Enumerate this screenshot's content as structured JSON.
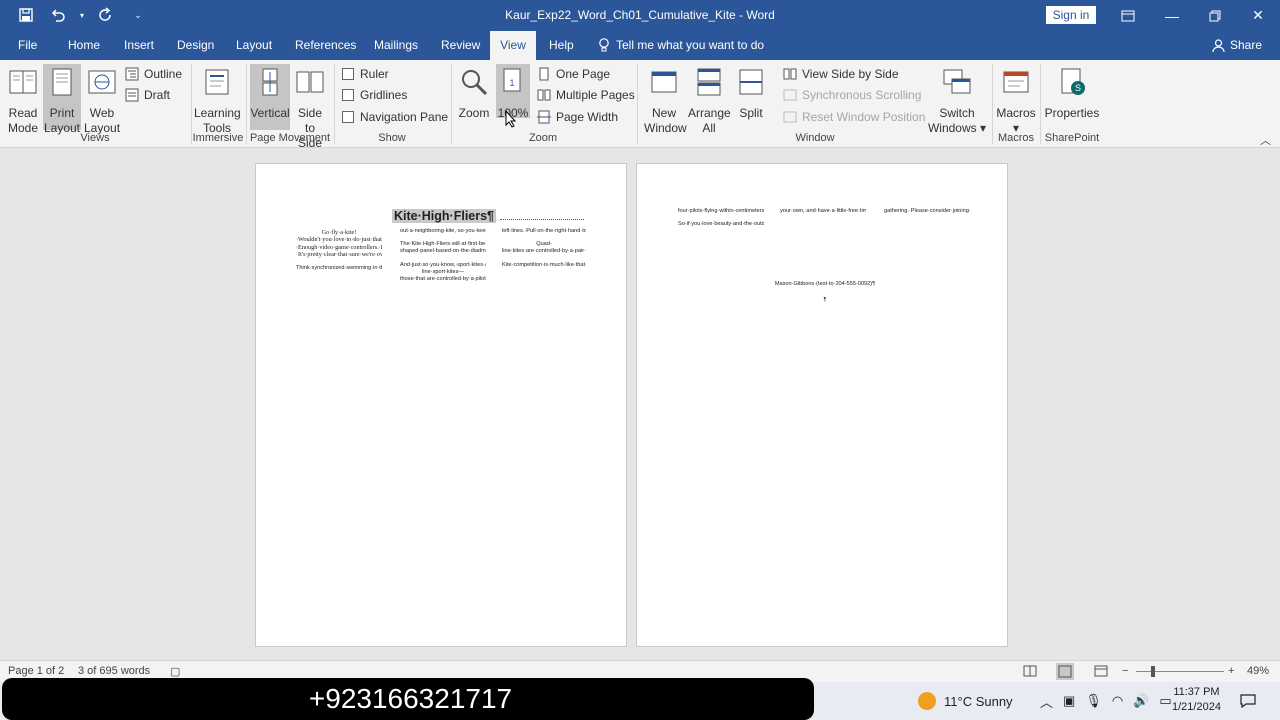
{
  "window": {
    "title": "Kaur_Exp22_Word_Ch01_Cumulative_Kite  -  Word",
    "signin": "Sign in"
  },
  "tabs": [
    "File",
    "Home",
    "Insert",
    "Design",
    "Layout",
    "References",
    "Mailings",
    "Review",
    "View",
    "Help"
  ],
  "tellme": "Tell me what you want to do",
  "share": "Share",
  "ribbon": {
    "views": {
      "label": "Views",
      "read_mode": "Read Mode",
      "print_layout": "Print Layout",
      "web_layout": "Web Layout",
      "outline": "Outline",
      "draft": "Draft"
    },
    "immersive": {
      "label": "Immersive",
      "learning_tools": "Learning Tools"
    },
    "page_movement": {
      "label": "Page Movement",
      "vertical": "Vertical",
      "side_to_side": "Side to Side"
    },
    "show": {
      "label": "Show",
      "ruler": "Ruler",
      "gridlines": "Gridlines",
      "navigation_pane": "Navigation Pane"
    },
    "zoom": {
      "label": "Zoom",
      "zoom": "Zoom",
      "hundred": "100%",
      "one_page": "One Page",
      "multiple_pages": "Multiple Pages",
      "page_width": "Page Width"
    },
    "window": {
      "label": "Window",
      "new_window": "New Window",
      "arrange_all": "Arrange All",
      "split": "Split",
      "view_side": "View Side by Side",
      "sync_scroll": "Synchronous Scrolling",
      "reset_pos": "Reset Window Position",
      "switch_windows": "Switch Windows"
    },
    "macros": {
      "label": "Macros",
      "macros": "Macros"
    },
    "sharepoint": {
      "label": "SharePoint",
      "properties": "Properties"
    }
  },
  "doc": {
    "heading": "Kite·High·Fliers¶",
    "p1_col1": "Go·fly·a·kite!·Wouldn't·you·love·to·do·just·that?·Enough·video·game·controllers.·Enough·research·reports·and·textbooks·and·inside·air.·How·about·getting·out·in·an·open·field·with·nothing·but·you·and·a·long·line·and·a·kite·that·you·can·make·dance?·It's·pretty·clear·that·sure·we're·oversaturated·with·devices·and·technology.·For·once,·you·should·be·the·controller·of·something·as·super·simple·as·a·sport·kite.·Think·about·it:·And·then·go·fly·it.·Just·you·and·the·wind·and·something·totally·within·your·control.¶",
    "p2_col1": "Think·synchronized·swimming·in·the·sky.·Yes,·a·team·is·involved.·And·it's·one·that·you·just·might·want·to·help·us·form.·The·Kite·High·Fliers.·You·could·be·part·of·the·very·first·competitive·kiting·club·on·campus.·Imagine·piloting·a·kite·120·feet·high,·wing·tip·to·wing·tip·with·others·on·the·same·team,·in·sync,·you·all·spin·the·kites·90·degrees·in·a·move·called·\"the·blender.\"·A·waver·of·just·six·inches·would·take·",
    "col2_a": "out·a·neighboring·kite,·so·you·keep·total·control.·And·the·kite·responds.·Put·your·engineering·skill·and·the·need·to·control·something·other·than·a·computer·screen·to·work·with·us.·You're·cordially·invited.¶",
    "col2_b": "The·Kite·High·Fliers·will·at·first·be·using·something·called·a·sport·kite.·A·sport·kite,·also·known·as·a·stunt·kite,·is·a·kite·that·can·be·maneuvered·in·the·air.·It·comes·in·various·shapes,·from·the·traditional·triangular·(delta)·shape·with·two·lines·for·control,·to·the·W-shaped·panel·based·on·the·diadmal·wing,·with·four·lines.·Such·kites·are·usually·constructed·from·lightweight·ripstop·nylon·or·polyester,·with·spars·made·from·carbon·fiber·tubing.·The·flying·lines·are·braided·polyethylene,·which·is·light·and·does·not·stretch·under·tension.¶",
    "col2_c": "And·just·so·you·know,·sport·kites·and·power·kites·are·not·out·of·reach·of·most·student·budgets.·In·addition,·if·we·get·approval·from·the·Office·of·Student·Activities,·we·will·be·able·to·apply·for·student·grants·to·help·fund·the·club,·its·equipment,·and·its·activities.·We'll·be·able·to·purchase·dual-line·sport·kites—those·that·are·controlled·by·a·pilot·adding·ad·releasing·tension·on·the·right·and·",
    "col3_a": "left·lines.·Pull·on·the·right·hand·to·turn·right,·left·to·turn·left,·pull·equally·for·straight·flight,·etc.·The·pitch·is·controlled·by·walking/running·forward·or·backwards,·giving·different·amounts·of·tension·to·the·lines.·Complex·tricks·and·patterns·are·flown,·including·turns,·loops,·and·landings.·The·kite·can·be·flipped·and·turned·end·over·end,·floating·gracefully·on·its·front·or·back,·diving·at·up·to·100·km/hour,·or·nearly·motionless.·It's·ballet·in·the·sky·at·high·speed.¶",
    "col3_b": "Quad-line·kites·are·controlled·by·a·pair·of·handles,·with·two·lines·attached·to·the·top·and·bottom·and·attached·to·the·kite.·A·bit·more·complex·than·dual·line,·all·four·lines·have·come·tension.·Some·lines·are·drawn·back·more·than·others.·Skilled·use·of·the·lines·allows·a·kite·to·be·tilted,·rotated,·twisted,·or·pitched·in·any·direction.·They·are·even·capable·of·reverse·flight,·axis·spins,·hovers,·and·side·to·side·flight.¶",
    "col3_c": "Kite·competition·is·much·like·that·of·figure·skating,·with·competitors·judged·in·compulsory·figures·and·interpretation·of·music.·We·can·compete·as·individuals,·a·pair·of·pilots,·or·as·a·team.·Team·flying·is·considered·the·most·spectacular,·with·",
    "p2_c1_a": "four·pilots·flying·within·centimeters·of·each·other,·avoiding·disaster·while·performing·figures·and·formations·high·in·the·air.¶",
    "p2_c1_b": "So·if·you·love·beauty·and·the·outdoors,·love·to·compete·as·a·team·or·on·",
    "p2_c2": "your·own,·and·have·a·little·free·time·that·you·want·to·put·to·good·use,·please·consider·supporting·us·in·the·quest·to·create·a·little·fun·for·ourselves.·We·will·meet·on·Monday·evening,·April·2,·in·the·Stone·Lodge·for·an·informative·Contact:→",
    "p2_c3": "gathering.·Please·consider·joining·us,·if·for·no·other·reason·than·to·consider·something·totally·out·of·the·ordinary·that·might·just·become·the·hobby·of·a·lifetime.·We·hope·to·see·you·there.¶",
    "p2_contact": "Mason·Gibbons·(text·to·204-555-0092)¶",
    "p2_mark": "¶"
  },
  "status": {
    "page": "Page 1 of 2",
    "words": "3 of 695 words",
    "zoom": "49%"
  },
  "taskbar": {
    "banner": "+923166321717",
    "weather": "11°C  Sunny",
    "time": "11:37 PM",
    "date": "1/21/2024"
  },
  "colors": {
    "accent": "#2b579a",
    "ribbon": "#f3f3f3",
    "canvas": "#e6e6e6"
  }
}
